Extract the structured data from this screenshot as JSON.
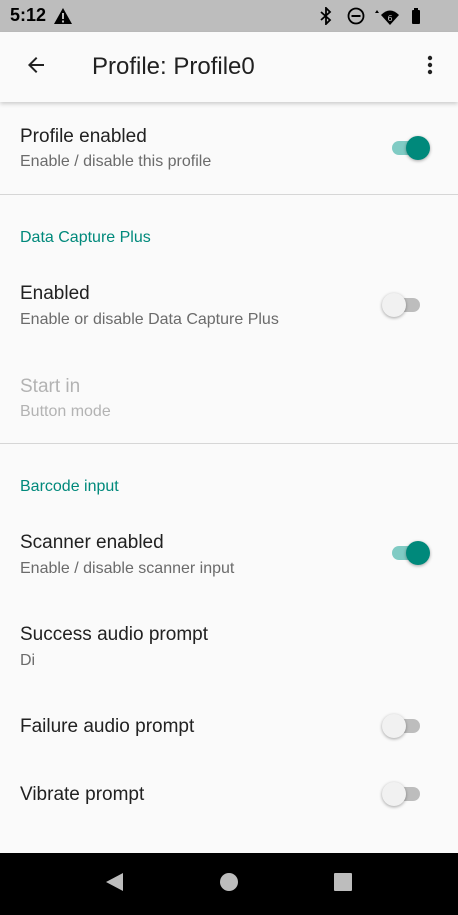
{
  "status_bar": {
    "time": "5:12",
    "icons": [
      "warning-icon",
      "bluetooth-icon",
      "do-not-disturb-icon",
      "wifi-icon",
      "battery-icon"
    ]
  },
  "app_bar": {
    "title": "Profile: Profile0",
    "back_icon": "arrow-back-icon",
    "menu_icon": "more-vert-icon"
  },
  "preferences": {
    "profile_enabled": {
      "title": "Profile enabled",
      "summary": "Enable / disable this profile",
      "checked": true
    },
    "data_capture_plus": {
      "header": "Data Capture Plus",
      "enabled": {
        "title": "Enabled",
        "summary": "Enable or disable Data Capture Plus",
        "checked": false
      },
      "start_in": {
        "title": "Start in",
        "summary": "Button mode",
        "disabled": true
      }
    },
    "barcode_input": {
      "header": "Barcode input",
      "scanner_enabled": {
        "title": "Scanner enabled",
        "summary": "Enable / disable scanner input",
        "checked": true
      },
      "success_audio": {
        "title": "Success audio prompt",
        "summary": "Di"
      },
      "failure_audio": {
        "title": "Failure audio prompt",
        "checked": false
      },
      "vibrate": {
        "title": "Vibrate prompt",
        "checked": false
      }
    }
  },
  "colors": {
    "accent": "#00897b",
    "accent_track": "#80cbc4",
    "status_bar": "#bdbdbd",
    "nav_bar": "#000000"
  },
  "nav_bar": {
    "buttons": [
      "back-triangle-icon",
      "home-circle-icon",
      "recents-square-icon"
    ]
  }
}
